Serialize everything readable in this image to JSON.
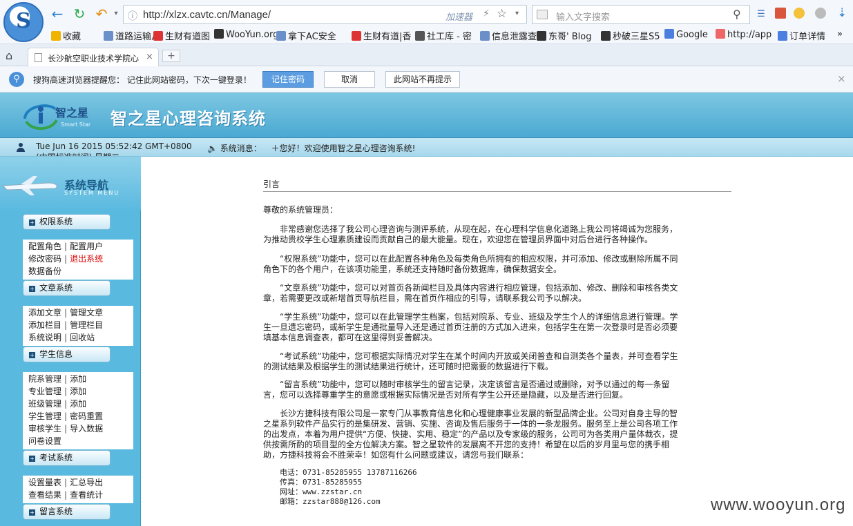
{
  "browser": {
    "logo_glyph": "S",
    "back_icon": "back-arrow-icon",
    "url": "http://xlzx.cavtc.cn/Manage/",
    "accelerator": "加速器",
    "search_placeholder": "输入文字搜索",
    "bookmarks": [
      {
        "label": "收藏",
        "color": "#f0b400"
      },
      {
        "label": "道路运输从",
        "color": "#6b8fc9"
      },
      {
        "label": "生财有道图",
        "color": "#d33"
      },
      {
        "label": "WooYun.org",
        "color": "#333"
      },
      {
        "label": "拿下AC安全",
        "color": "#6b8fc9"
      },
      {
        "label": "生财有道|香",
        "color": "#d33"
      },
      {
        "label": "社工库 - 密",
        "color": "#555"
      },
      {
        "label": "信息泄露查",
        "color": "#6b8fc9"
      },
      {
        "label": "东哥' Blog",
        "color": "#333"
      },
      {
        "label": "秒破三星S5",
        "color": "#333"
      },
      {
        "label": "Google",
        "color": "#4a7fe0"
      },
      {
        "label": "http://app",
        "color": "#e66"
      },
      {
        "label": "订单详情",
        "color": "#4a7fe0"
      }
    ],
    "tab_title": "长沙航空职业技术学院心",
    "new_tab": "+",
    "notice_text": "搜狗高速浏览器提醒您：  记住此网站密码，下次一键登录！",
    "remember_btn": "记住密码",
    "cancel_btn": "取消",
    "never_btn": "此网站不再提示",
    "close": "×"
  },
  "app": {
    "logo_text": "智之星",
    "logo_sub": "Smart Star",
    "title": "智之星心理咨询系统",
    "datetime": "Tue Jun 16 2015 05:52:42 GMT+0800 (中国标准时间) 星期二",
    "sysmsg_label": "系统消息：",
    "sysmsg_text": "＋您好！欢迎使用智之星心理咨询系统!",
    "accent": "#5ab9df"
  },
  "sidebar": {
    "title": "系统导航",
    "subtitle": "SYSTEM MENU",
    "sections": [
      {
        "label": "权限系统",
        "lines": [
          [
            "配置角色",
            "配置用户"
          ],
          [
            "修改密码",
            "退出系统"
          ],
          [
            "数据备份"
          ]
        ]
      },
      {
        "label": "文章系统",
        "lines": [
          [
            "添加文章",
            "管理文章"
          ],
          [
            "添加栏目",
            "管理栏目"
          ],
          [
            "系统说明",
            "回收站"
          ]
        ]
      },
      {
        "label": "学生信息",
        "lines": [
          [
            "院系管理",
            "添加"
          ],
          [
            "专业管理",
            "添加"
          ],
          [
            "班级管理",
            "添加"
          ],
          [
            "学生管理",
            "密码重置"
          ],
          [
            "审核学生",
            "导入数据"
          ],
          [
            "问卷设置"
          ]
        ]
      },
      {
        "label": "考试系统",
        "lines": [
          [
            "设置量表",
            "汇总导出"
          ],
          [
            "查看结果",
            "查看统计"
          ]
        ]
      },
      {
        "label": "留言系统",
        "lines": []
      }
    ]
  },
  "main": {
    "heading": "引言",
    "greeting": "尊敬的系统管理员：",
    "paragraphs": [
      "　　非常感谢您选择了我公司心理咨询与测评系统，从现在起，在心理科学信息化道路上我公司将竭诚为您服务，为推动贵校学生心理素质建设而贡献自己的最大能量。现在，欢迎您在管理员界面中对后台进行各种操作。",
      "　　“权限系统”功能中，您可以在此配置各种角色及每类角色所拥有的相应权限，并可添加、修改或删除所属不同角色下的各个用户，在该项功能里，系统还支持随时备份数据库，确保数据安全。",
      "　　“文章系统”功能中，您可以对首页各新闻栏目及具体内容进行相应管理，包括添加、修改、删除和审核各类文章，若需要更改或新增首页导航栏目，需在首页作相应的引导，请联系我公司予以解决。",
      "　　“学生系统”功能中，您可以在此管理学生档案，包括对院系、专业、班级及学生个人的详细信息进行管理。学生一旦遗忘密码，或新学生是通批量导入还是通过首页注册的方式加入进来，包括学生在第一次登录时是否必须要填基本信息调查表，都可在这里得到妥善解决。",
      "　　“考试系统”功能中，您可根据实际情况对学生在某个时间内开放或关闭普查和自测类各个量表，并可查看学生的测试结果及根据学生的测试结果进行统计，还可随时把需要的数据进行下载。",
      "　　“留言系统”功能中，您可以随时审核学生的留言记录，决定该留言是否通过或删除，对予以通过的每一条留言，您可以选择尊重学生的意愿或根据实际情况是否对所有学生公开还是隐藏，以及是否进行回复。",
      "　　长沙方捷科技有限公司是一家专门从事教育信息化和心理健康事业发展的新型品牌企业。公司对自身主导的智之星系列软件产品实行的是集研发、营销、实施、咨询及售后服务于一体的一条龙服务。服务至上是公司各项工作的出发点，本着为用户提供“方便、快捷、实用、稳定”的产品以及专家级的服务，公司可为各类用户量体裁衣，提供按需所酌的项目型的全方位解决方案。智之星软件的发展离不开您的支持！希望在以后的岁月里与您的携手相助，方捷科技将会不胜荣幸！如您有什么问题或建议，请您与我们联系："
    ],
    "contact": [
      "电话：0731-85285955 13787116266",
      "传真：0731-85285955",
      "网址：www.zzstar.cn",
      "邮箱：zzstar888@126.com"
    ]
  },
  "watermark": "www.wooyun.org"
}
